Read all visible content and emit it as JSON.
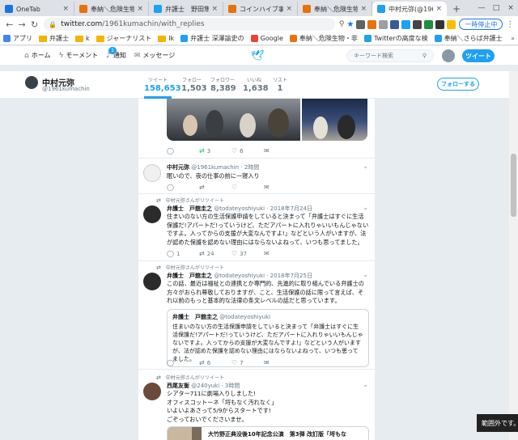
{
  "browser": {
    "tabs": [
      {
        "title": "OneTab",
        "color": "#1a73e8"
      },
      {
        "title": "奉納＼危険生物・非",
        "color": "#e8710a"
      },
      {
        "title": "弁護士　野田隼人",
        "color": "#1da1f2"
      },
      {
        "title": "コインハイブ事件",
        "color": "#e8710a"
      },
      {
        "title": "奉納＼危険生物・非",
        "color": "#e8710a"
      },
      {
        "title": "中村元弥(@1961k",
        "color": "#1da1f2",
        "active": true
      }
    ],
    "new_tab": "+",
    "url_host": "twitter.com",
    "url_path": "/1961kumachin/with_replies",
    "pause_label": "一時停止中",
    "bookmarks": [
      {
        "label": "アプリ",
        "kind": "apps"
      },
      {
        "label": "弁護士",
        "kind": "folder"
      },
      {
        "label": "k",
        "kind": "folder"
      },
      {
        "label": "ジャーナリスト",
        "kind": "folder"
      },
      {
        "label": "lk",
        "kind": "folder"
      },
      {
        "label": "弁護士 深澤諭史の",
        "kind": "twitter"
      },
      {
        "label": "Google",
        "kind": "google"
      },
      {
        "label": "奉納＼危険生物・非",
        "kind": "orange"
      },
      {
        "label": "Twitterの高度な検",
        "kind": "twitter"
      },
      {
        "label": "奉納＼さらば弁護士",
        "kind": "twitter"
      }
    ],
    "bookmarks_more": "»"
  },
  "twitter_nav": {
    "home": "ホーム",
    "moments": "モーメント",
    "notifications": "通知",
    "notif_count": "1",
    "messages": "メッセージ",
    "search_placeholder": "キーワード検索",
    "tweet_button": "ツイート"
  },
  "profile": {
    "name": "中村元弥",
    "handle": "@1961kumachin",
    "stats": [
      {
        "label": "ツイート",
        "value": "158,653",
        "active": true
      },
      {
        "label": "フォロー",
        "value": "1,503"
      },
      {
        "label": "フォロワー",
        "value": "8,389"
      },
      {
        "label": "いいね",
        "value": "1,638"
      },
      {
        "label": "リスト",
        "value": "1"
      }
    ],
    "follow_button": "フォローする"
  },
  "tweets": [
    {
      "actions": {
        "reply": "",
        "retweet": "3",
        "like": "6"
      }
    },
    {
      "name": "中村元弥",
      "handle": "@1961kumachin",
      "time": "2時間",
      "text": "眠いので、夜の仕事の前に一寝入り",
      "actions": {
        "reply": "",
        "retweet": "",
        "like": ""
      }
    },
    {
      "rt_by": "中村元弥さんがリツイート",
      "name": "弁護士　戸舘圭之",
      "handle": "@todateyoshiyuki",
      "time": "2018年7月24日",
      "text": "住まいのない方の生活保護申請をしていると決まって「弁護士はすぐに生活保護だ!アパートだ!っていうけど、ただアパートに入れりゃいいもんじゃないですよ。入ってからの支援が大変なんですよ!」などという人がいますが、法が認めた保護を認めない理由にはならないよねって、いつも思ってました。",
      "actions": {
        "reply": "1",
        "retweet": "24",
        "like": "37"
      }
    },
    {
      "rt_by": "中村元弥さんがリツイート",
      "name": "弁護士　戸舘圭之",
      "handle": "@todateyoshiyuki",
      "time": "2018年7月25日",
      "text": "この話、最近は福祉との連携とか専門的、先進的に取り組んでいる弁護士の方々がおられ尊敬しておりますが、こと、生活保護の話に限って言えば、それ以前のもっと基本的な法律の条文レベルの話だと思っています。",
      "quote": {
        "name": "弁護士　戸舘圭之",
        "handle": "@todateyoshiyuki",
        "text": "住まいのない方の生活保護申請をしていると決まって「弁護士はすぐに生活保護だ!アパートだ!っていうけど、ただアパートに入れりゃいいもんじゃないですよ。入ってからの支援が大変なんですよ!」などという人がいますが、法が認めた保護を認めない理由にはならないよねって、いつも思ってました。"
      },
      "actions": {
        "reply": "",
        "retweet": "6",
        "like": "7"
      }
    },
    {
      "rt_by": "中村元弥さんがリツイート",
      "name": "西尾友衡",
      "handle": "@240yuki",
      "time": "3時間",
      "lines": [
        "シアター711に劇場入りしました!",
        "オフィスコットーネ「埒もなく汚れなく」",
        "いよいよあさって5/9からスタートです!",
        "ごぞっておいでくださいませ。"
      ],
      "card_title": "大竹野正典没後10年記念公演　第3弾 改訂版「埒もな"
    }
  ],
  "icons": {
    "reply": "reply-icon",
    "retweet": "retweet-icon",
    "like": "heart-icon",
    "dm": "mail-icon"
  },
  "toast": "範囲外です。"
}
